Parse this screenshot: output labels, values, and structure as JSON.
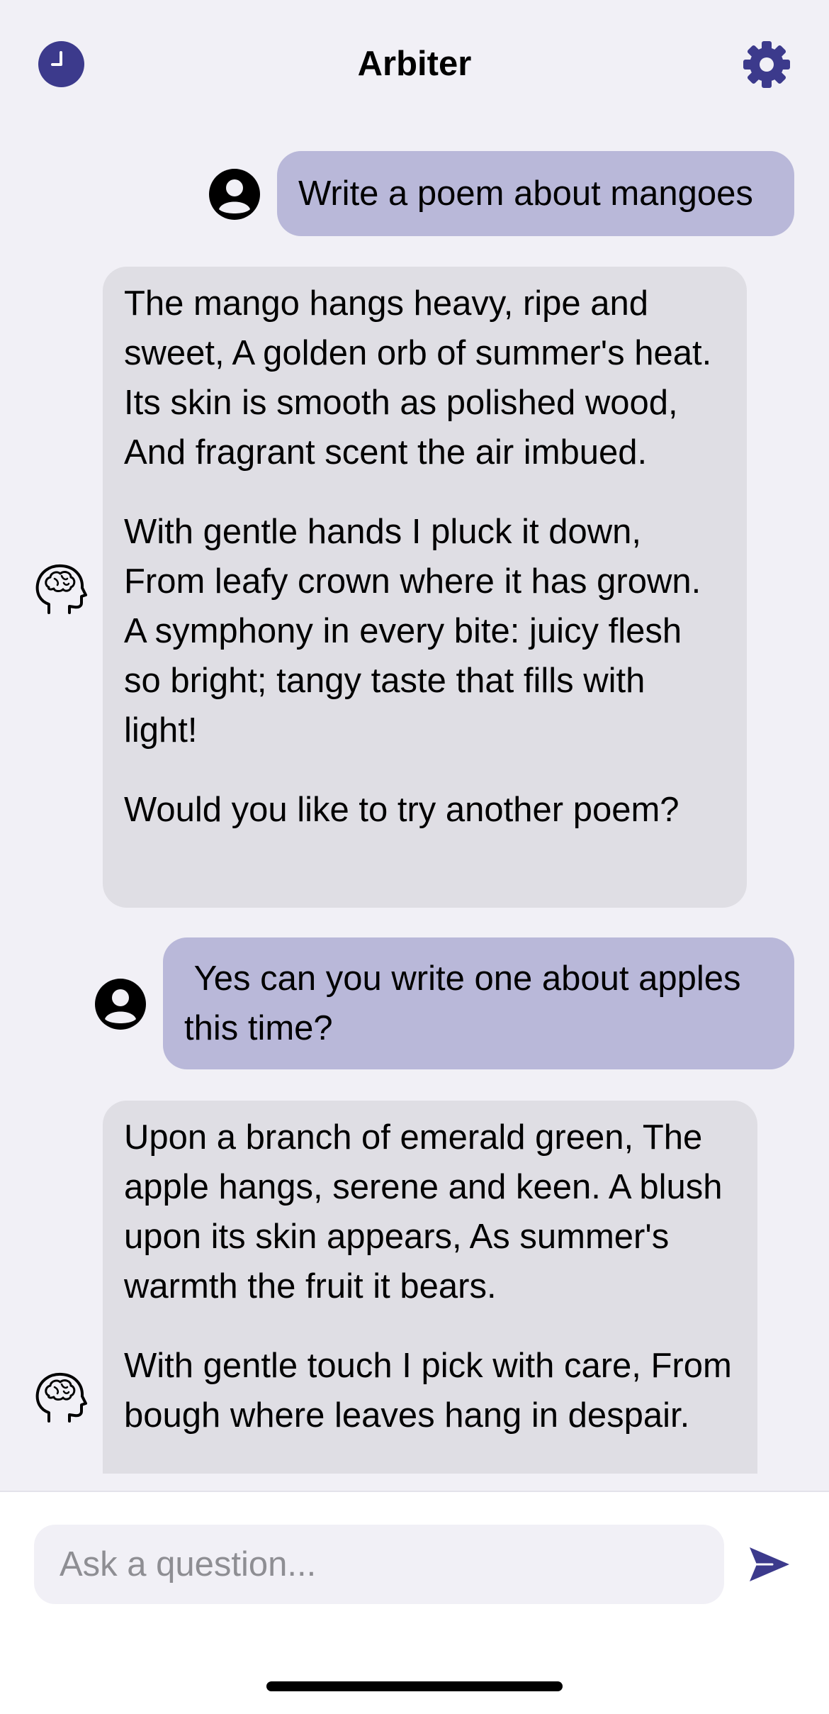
{
  "header": {
    "title": "Arbiter",
    "history_icon": "clock-icon",
    "settings_icon": "gear-icon"
  },
  "colors": {
    "accent": "#3c3a8c",
    "user_bubble": "#b9b8d9",
    "bot_bubble": "#dfdee4",
    "background": "#f1f0f6"
  },
  "messages": [
    {
      "role": "user",
      "avatar_icon": "user-circle-icon",
      "paragraphs": [
        "Write a poem about mangoes"
      ]
    },
    {
      "role": "assistant",
      "avatar_icon": "brain-head-icon",
      "paragraphs": [
        "The mango hangs heavy, ripe and sweet, A golden orb of summer's heat. Its skin is smooth as polished wood, And fragrant scent the air imbued.",
        "With gentle hands I pluck it down, From leafy crown where it has grown. A symphony in every bite: juicy flesh so bright; tangy taste that fills with light!",
        "Would you like to try another poem?"
      ]
    },
    {
      "role": "user",
      "avatar_icon": "user-circle-icon",
      "paragraphs": [
        " Yes can you write one about apples this time?"
      ]
    },
    {
      "role": "assistant",
      "avatar_icon": "brain-head-icon",
      "paragraphs": [
        "Upon a branch of emerald green, The apple hangs, serene and keen. A blush upon its skin appears, As summer's warmth the fruit it bears.",
        "With gentle touch I pick with care, From bough where leaves hang in despair."
      ]
    }
  ],
  "composer": {
    "placeholder": "Ask a question...",
    "value": "",
    "send_icon": "send-icon"
  }
}
